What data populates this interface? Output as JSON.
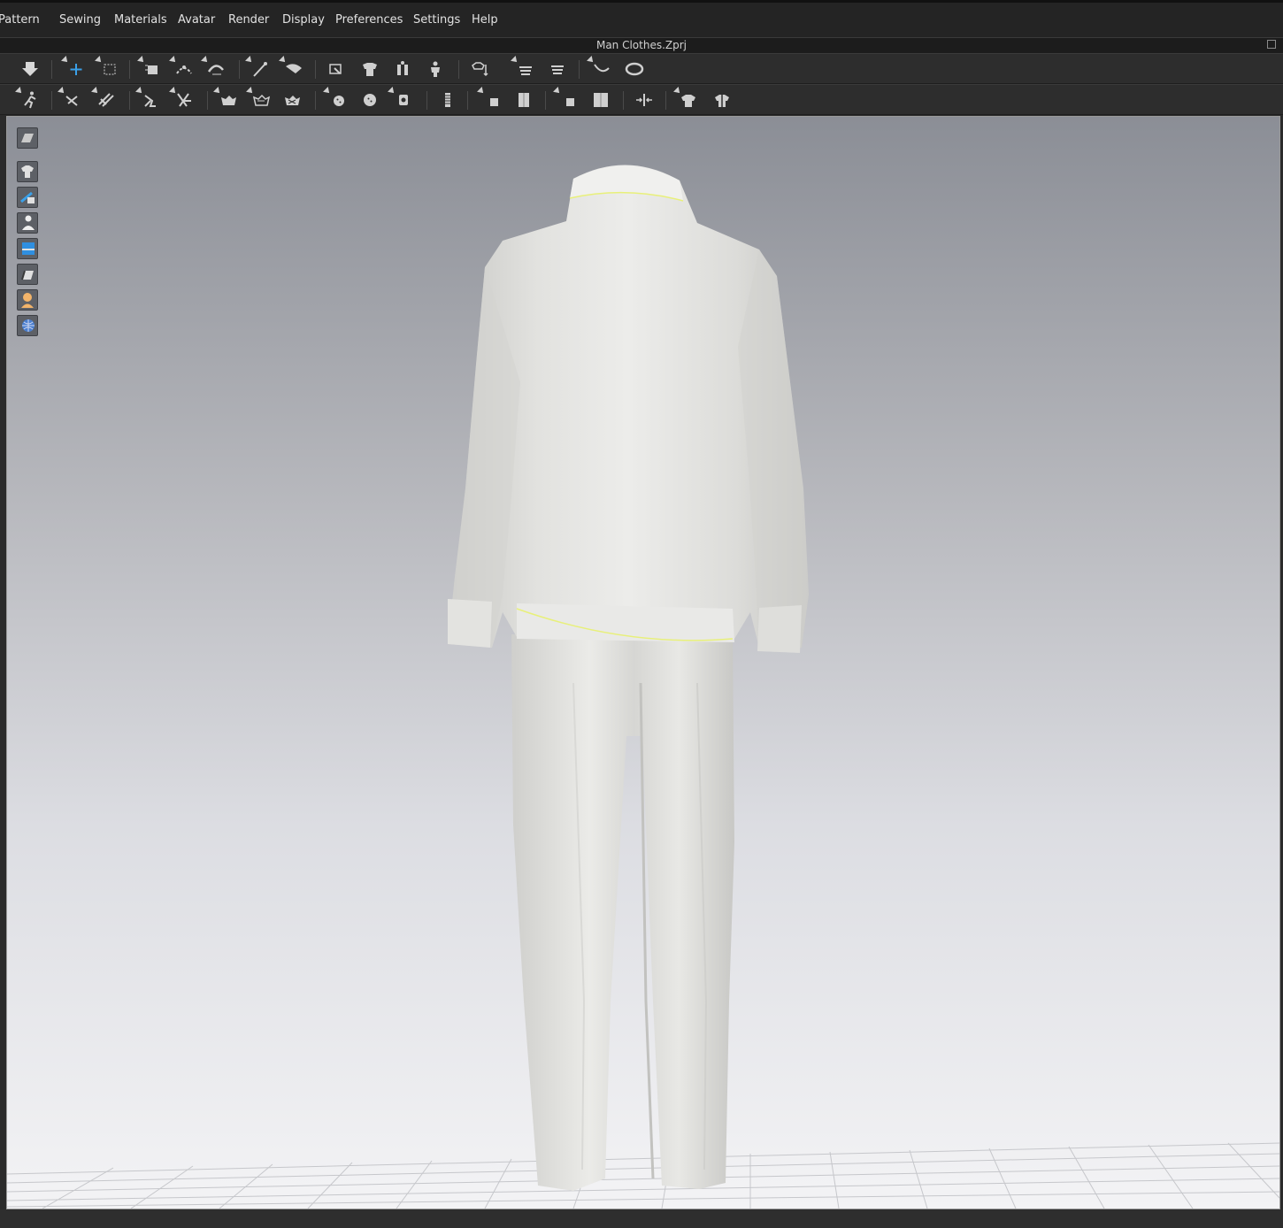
{
  "menu": [
    "Pattern",
    "Sewing",
    "Materials",
    "Avatar",
    "Render",
    "Display",
    "Preferences",
    "Settings",
    "Help"
  ],
  "window": {
    "title": "Man Clothes.Zprj"
  },
  "toolbar_top": [
    {
      "name": "simulation-icon"
    },
    {
      "name": "select-move-icon"
    },
    {
      "name": "select-box-icon"
    },
    {
      "name": "transform-pattern-icon"
    },
    {
      "name": "edit-curve-point-icon"
    },
    {
      "name": "edit-curvature-icon"
    },
    {
      "name": "pin-icon"
    },
    {
      "name": "select-mesh-icon"
    },
    {
      "name": "fold-arrangement-icon"
    },
    {
      "name": "garment-fit-icon"
    },
    {
      "name": "arrange-avatar-icon"
    },
    {
      "name": "arrangement-point-icon"
    },
    {
      "name": "layer-clone-icon"
    },
    {
      "name": "layer-stack-icon"
    },
    {
      "name": "measure-tape-icon"
    },
    {
      "name": "circumference-measure-icon"
    }
  ],
  "toolbar_bottom": [
    {
      "name": "avatar-pose-icon"
    },
    {
      "name": "tack-icon"
    },
    {
      "name": "tack-on-avatar-icon"
    },
    {
      "name": "steam-icon"
    },
    {
      "name": "edit-tack-icon"
    },
    {
      "name": "puckering-icon"
    },
    {
      "name": "shirring-icon"
    },
    {
      "name": "smocking-icon"
    },
    {
      "name": "button-icon"
    },
    {
      "name": "select-button-icon"
    },
    {
      "name": "buttonhole-icon"
    },
    {
      "name": "zipper-icon"
    },
    {
      "name": "fold-3d-icon"
    },
    {
      "name": "fold-3d-restore-icon"
    },
    {
      "name": "flatten-icon"
    },
    {
      "name": "flatten-restore-icon"
    },
    {
      "name": "align-center-icon"
    },
    {
      "name": "garment-style-icon"
    },
    {
      "name": "garment-style-edit-icon"
    }
  ],
  "side_toolbar": [
    {
      "name": "view-mode-icon"
    },
    {
      "name": "show-garment-icon"
    },
    {
      "name": "show-pattern-icon"
    },
    {
      "name": "show-avatar-icon"
    },
    {
      "name": "texture-view-icon"
    },
    {
      "name": "thickness-view-icon"
    },
    {
      "name": "avatar-skin-icon"
    },
    {
      "name": "environment-icon"
    }
  ],
  "colors": {
    "accent_blue": "#3aa0e8",
    "seam_highlight": "#e8f07a",
    "garment": "#e6e6e3"
  }
}
